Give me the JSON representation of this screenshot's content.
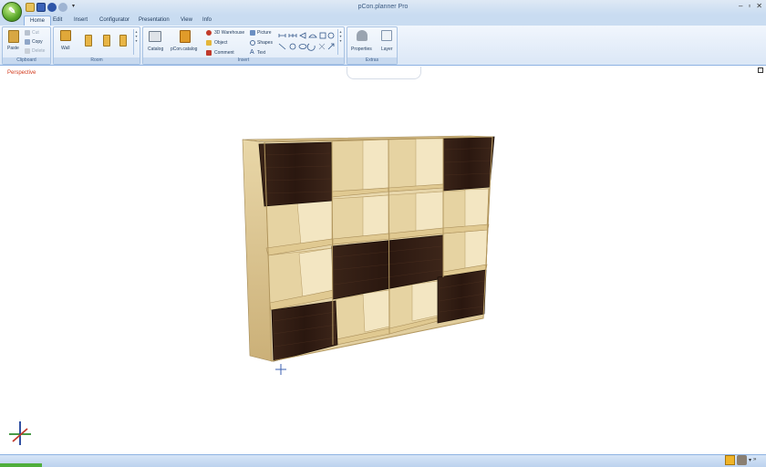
{
  "window": {
    "title": "pCon.planner Pro"
  },
  "tabs": [
    {
      "label": "Home",
      "active": true
    },
    {
      "label": "Edit"
    },
    {
      "label": "Insert"
    },
    {
      "label": "Configurator"
    },
    {
      "label": "Presentation"
    },
    {
      "label": "View"
    },
    {
      "label": "Info"
    }
  ],
  "ribbon": {
    "clipboard": {
      "label": "Clipboard",
      "paste": "Paste",
      "cut": "Cut",
      "copy": "Copy",
      "delete": "Delete"
    },
    "room": {
      "label": "Room",
      "wall": "Wall"
    },
    "insert": {
      "label": "Insert",
      "catalog": "Catalog",
      "pcon_catalog": "pCon.catalog",
      "warehouse": "3D Warehouse",
      "object": "Object",
      "comment": "Comment",
      "picture": "Picture",
      "shapes": "Shapes",
      "text": "Text"
    },
    "extras": {
      "label": "Extras",
      "properties": "Properties",
      "layer": "Layer"
    }
  },
  "viewport": {
    "view_label": "Perspective"
  },
  "colors": {
    "accent": "#c9dcf1",
    "wood_light": "#e2cf9c",
    "wood_dark": "#3a2418",
    "view_label": "#d23a1c"
  },
  "icons": [
    "app-orb-icon",
    "save-icon",
    "undo-icon",
    "redo-icon",
    "rss-icon",
    "facebook-icon",
    "help-icon",
    "paste-icon",
    "wall-icon",
    "catalog-icon",
    "properties-icon",
    "layer-icon",
    "axes-icon"
  ]
}
